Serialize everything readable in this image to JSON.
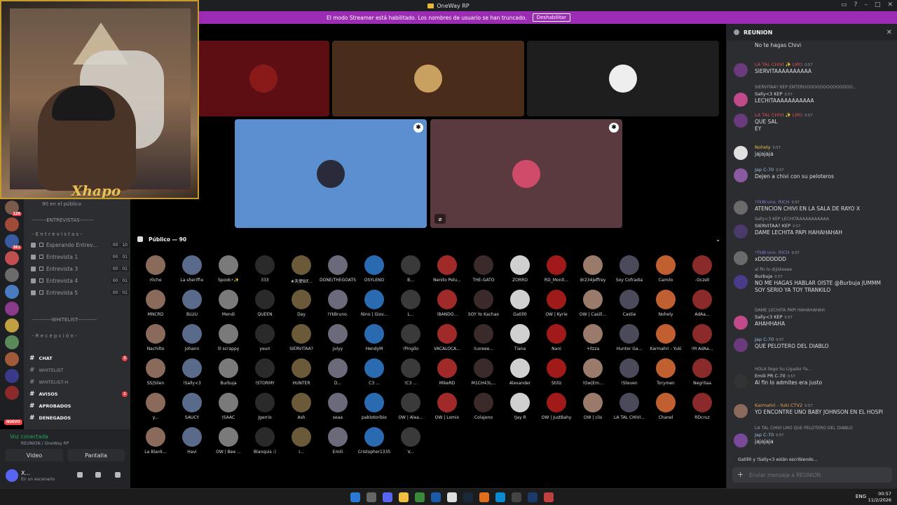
{
  "window": {
    "title": "OneWay RP"
  },
  "banner": {
    "text": "El modo Streamer está habilitado. Los nombres de usuario se han truncado.",
    "button": "Deshabilitar"
  },
  "webcam": {
    "overlay_text": "Xhapo"
  },
  "server_badges": [
    "126",
    "361"
  ],
  "nuevo_label": "NUEVO",
  "channels": {
    "public_count": "90 en el público",
    "dividers": [
      "--------ENTREVISTAS--------",
      "- E n t r e v i s t a s -",
      "-----------WHITELIST-----------",
      "- R e c e p c i ó n -"
    ],
    "voice": [
      {
        "label": "Esperando Entrev...",
        "counts": [
          "00",
          "10"
        ]
      },
      {
        "label": "Entrevista 1",
        "counts": [
          "00",
          "01"
        ]
      },
      {
        "label": "Entrevista 3",
        "counts": [
          "00",
          "01"
        ]
      },
      {
        "label": "Entrevista 4",
        "counts": [
          "00",
          "01"
        ]
      },
      {
        "label": "Entrevista 5",
        "counts": [
          "00",
          "01"
        ]
      }
    ],
    "text": [
      {
        "label": "CHAT",
        "bold": true,
        "unread": "3"
      },
      {
        "label": "WHITELIST",
        "bold": false
      },
      {
        "label": "WHITELIST-H",
        "bold": false
      },
      {
        "label": "AVISOS",
        "bold": true,
        "unread": "1"
      },
      {
        "label": "APROBADOS",
        "bold": true
      },
      {
        "label": "DENEGADOS",
        "bold": true
      }
    ]
  },
  "voice_panel": {
    "status": "Voz conectada",
    "sub": "REUNION / OneWay RP",
    "video": "Video",
    "screen": "Pantalla"
  },
  "user": {
    "name": "X...",
    "status": "En un escenario"
  },
  "stage": {
    "public_header": "Público — 90"
  },
  "audience": [
    "r0che",
    "La sheriff☠",
    "Spook⚡✨",
    "333",
    "★天使Bif...",
    "DONE/THEGOATS",
    "OSYLENO",
    "B...",
    "Nenito Pelu...",
    "THE-GATO",
    "ZORRO",
    "RD_Monit...",
    "dr234jeffrey",
    "Soy Cofradia",
    "Camilo",
    "-Oczell",
    "MNCRD",
    "BLUU",
    "Mendi",
    "QUEEN",
    "Day",
    "!YkBruno.",
    "Nino | Giov...",
    "L...",
    "!BANDO...",
    "SOY Yo Kachao",
    "Gatill0",
    "OW | Kyrie",
    "OW | Casill...",
    "Castie",
    "Nohely",
    "AdAa...",
    "Nachilto",
    "Johann",
    "lil scrappy",
    "yeuri",
    "SIERVITAA?",
    "Julyy",
    "HendyM",
    "!Pingilo",
    "VACALOCA...",
    "!Loreee...",
    "Tiana",
    "Nani",
    "+Ilzza",
    "Hunter Ga...",
    "Karmahri - Yuki",
    "!M AdAa...",
    "SS|Silen",
    "!Sally<3",
    "Burbuja",
    "!STORMY",
    "HUNTER",
    "D...",
    "C3 ...",
    "!C3 ...",
    "MikeRD",
    "M1CH43L...",
    "Alexander",
    "Stillz",
    "!Ow|Em...",
    "!Steven",
    "Torymen",
    "Negritaa",
    "y...",
    "SAUCY",
    "ISAAC",
    "Jgerrio",
    "Ash",
    "seaa",
    "pablotoribio",
    "OW | Alea...",
    "OW | Lomix",
    "Colajeno",
    "!Jay R",
    "OW | JustBahy",
    "OW | clis",
    "LA TAL CHIVI...",
    "Chanel",
    "RDcruz",
    "La Blank...",
    "Havi",
    "OW | Bee ...",
    "Blanquis :)",
    "I...",
    "Emili",
    "Cristopher1335",
    "V..."
  ],
  "chat": {
    "channel": "REUNION",
    "messages": [
      {
        "name": "",
        "time": "",
        "text": "No te hagas Chivi",
        "reply": ""
      },
      {
        "name": "LA TAL CHIVI ✨ LMO",
        "time": "0:57",
        "text": "SIERVITAAAAAAAAAA",
        "reply": ""
      },
      {
        "name": "Sally<3 KEP",
        "time": "0:57",
        "text": "LECHITAAAAAAAAAAA",
        "reply": "SIERVITAA? KEP ENTEROOOOOOOOOOOOOOO..."
      },
      {
        "name": "LA TAL CHIVI ✨ LMO",
        "time": "0:57",
        "text": "QUE SAL",
        "text2": "EY",
        "reply": ""
      },
      {
        "name": "Nohely",
        "time": "0:57",
        "text": "jajajaja",
        "reply": ""
      },
      {
        "name": "Jap C-70",
        "time": "0:57",
        "text": "Dejen a chivi con su peloteros",
        "reply": ""
      },
      {
        "name": "!YkBruno. RICH",
        "time": "0:57",
        "text": "ATENCION CHIVI EN LA SALA DE RAYO X",
        "reply": ""
      },
      {
        "name": "SIERVITAA? KEP",
        "time": "0:57",
        "text": "DAME LECHITA PAPI HAHAHAHAH",
        "reply": "Sally<3 KEP LECHITAAAAAAAAAAA"
      },
      {
        "name": "!YkBruno. RICH",
        "time": "0:57",
        "text": "xDDDDDDD",
        "reply": ""
      },
      {
        "name": "Burbuja",
        "time": "0:57",
        "text": "NO ME HAGAS HABLAR OISTE @Burbuja JUMMM",
        "text2": "SOY SERIO YA TOY TRANKILO",
        "reply": "al fin lo dijisteeee"
      },
      {
        "name": "Sally<3 KEP",
        "time": "0:57",
        "text": "AHAHHAHA",
        "reply": "DAME LECHITA PAPI HAHAHAHAH"
      },
      {
        "name": "Jap C-70",
        "time": "0:57",
        "text": "QUE PELOTERO DEL DIABLO",
        "reply": ""
      },
      {
        "name": "Emili PR C-70",
        "time": "0:57",
        "text": "Al fin lo admites era justo",
        "reply": "HOLA llego Su Ligador Fa..."
      },
      {
        "name": "Karmahri - Yuki CTV2",
        "time": "0:57",
        "text": "YO ENCONTRE UNO BABY JOHNSON EN EL HOSPI",
        "reply": ""
      },
      {
        "name": "Jap C-70",
        "time": "0:57",
        "text": "jajajaja",
        "reply": "LA TAL CHIVI LMO QUE PELOTERO DEL DIABLO"
      }
    ],
    "typing": "Gatill0 y !Sally<3 están escribiendo...",
    "input_placeholder": "Enviar mensaje a  REUNION"
  },
  "taskbar": {
    "tray": "ENG",
    "time": "00:57",
    "date": "11/2/2026"
  },
  "colors": {
    "banner": "#9b2cb3",
    "accent": "#5865f2",
    "gold": "#c79b2c"
  }
}
